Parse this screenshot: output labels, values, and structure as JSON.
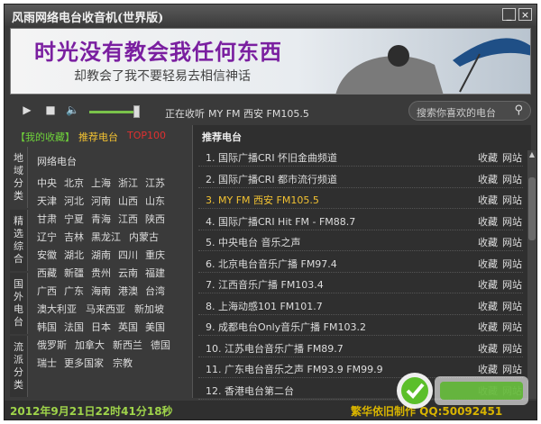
{
  "window": {
    "title": "风雨网络电台收音机(世界版)",
    "min_label": "_",
    "close_label": "×"
  },
  "banner": {
    "line1": "时光没有教会我任何东西",
    "line2": "却教会了我不要轻易去相信神话"
  },
  "player": {
    "play_icon": "▶",
    "stop_icon": "■",
    "volume_icon": "🔈",
    "volume_level": 0.82,
    "now_playing_label": "正在收听",
    "now_playing_value": "MY FM 西安 FM105.5",
    "search_placeholder": "搜索你喜欢的电台"
  },
  "left_tabs": {
    "favorites": "【我的收藏】",
    "recommended": "推荐电台",
    "top": "TOP100"
  },
  "categories": [
    {
      "label": "地域分类"
    },
    {
      "label": "精选综合"
    },
    {
      "label": "国外电台"
    },
    {
      "label": "流派分类"
    }
  ],
  "region_grid": {
    "title": "网络电台",
    "rows": [
      [
        "中央",
        "北京",
        "上海",
        "浙江",
        "江苏"
      ],
      [
        "天津",
        "河北",
        "河南",
        "山西",
        "山东"
      ],
      [
        "甘肃",
        "宁夏",
        "青海",
        "江西",
        "陕西"
      ],
      [
        "辽宁",
        "吉林",
        "黑龙江",
        "内蒙古"
      ],
      [
        "安徽",
        "湖北",
        "湖南",
        "四川",
        "重庆"
      ],
      [
        "西藏",
        "新疆",
        "贵州",
        "云南",
        "福建"
      ],
      [
        "广西",
        "广东",
        "海南",
        "港澳",
        "台湾"
      ],
      [
        "澳大利亚",
        "马来西亚",
        "新加坡"
      ],
      [
        "韩国",
        "法国",
        "日本",
        "英国",
        "美国"
      ],
      [
        "俄罗斯",
        "加拿大",
        "新西兰",
        "德国"
      ],
      [
        "瑞士",
        "更多国家",
        "宗教"
      ]
    ]
  },
  "station_list": {
    "header": "推荐电台",
    "fav_label": "收藏",
    "site_label": "网站",
    "active_index": 2,
    "stations": [
      "1. 国际广播CRI 怀旧金曲频道",
      "2. 国际广播CRI 都市流行频道",
      "3. MY FM 西安 FM105.5",
      "4. 国际广播CRI Hit FM - FM88.7",
      "5. 中央电台 音乐之声",
      "6. 北京电台音乐广播 FM97.4",
      "7. 江西音乐广播 FM103.4",
      "8. 上海动感101 FM101.7",
      "9. 成都电台Only音乐广播 FM103.2",
      "10. 江苏电台音乐广播 FM89.7",
      "11. 广东电台音乐之声 FM93.9 FM99.9",
      "12. 香港电台第二台"
    ]
  },
  "status": {
    "datetime": "2012年9月21日22时41分18秒",
    "credit": "繁华依旧制作 QQ:50092451"
  },
  "colors": {
    "accent_green": "#9fd44a",
    "accent_yellow": "#f2c232",
    "tab_red": "#e03030"
  }
}
